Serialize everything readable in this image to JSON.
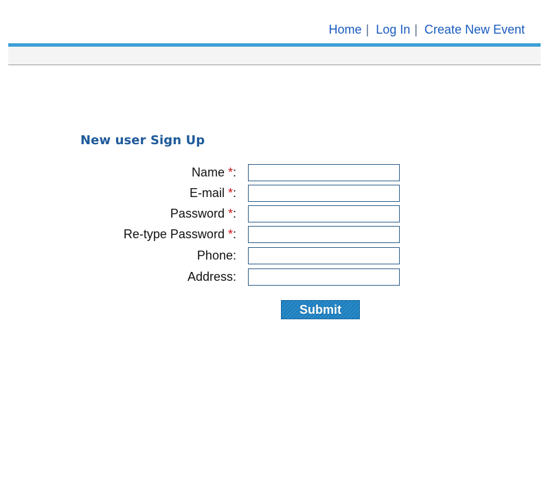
{
  "nav": {
    "home": "Home",
    "login": "Log In",
    "create_event": "Create New Event",
    "separator": "|"
  },
  "form": {
    "title": "New user Sign Up",
    "required_marker": "*",
    "fields": [
      {
        "label": "Name",
        "required": true,
        "value": ""
      },
      {
        "label": "E-mail",
        "required": true,
        "value": ""
      },
      {
        "label": "Password",
        "required": true,
        "value": ""
      },
      {
        "label": "Re-type Password",
        "required": true,
        "value": ""
      },
      {
        "label": "Phone",
        "required": false,
        "value": ""
      },
      {
        "label": "Address",
        "required": false,
        "value": ""
      }
    ],
    "colon": ":",
    "submit_label": "Submit"
  },
  "colors": {
    "link": "#1a5bbf",
    "header_accent": "#3d9fd6",
    "title": "#1e5a9a",
    "required": "#cc1111",
    "button": "#2a8cc9"
  }
}
